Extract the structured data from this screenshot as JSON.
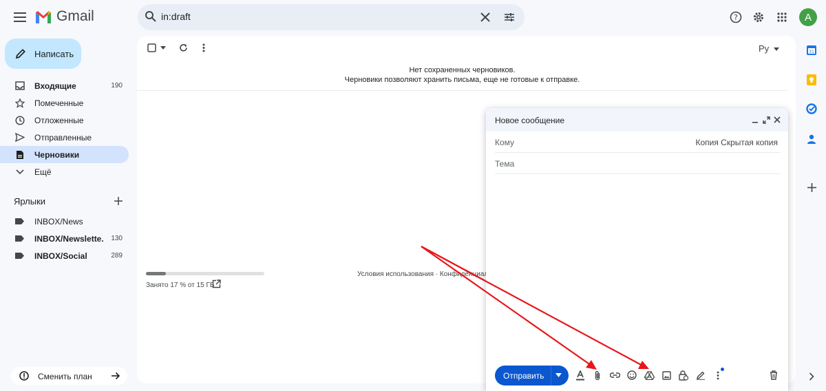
{
  "app": {
    "name": "Gmail"
  },
  "search": {
    "value": "in:draft"
  },
  "account": {
    "initial": "A"
  },
  "compose_button": {
    "label": "Написать"
  },
  "nav": [
    {
      "label": "Входящие",
      "count": "190",
      "bold": true,
      "icon": "inbox-icon"
    },
    {
      "label": "Помеченные",
      "count": "",
      "bold": false,
      "icon": "star-icon"
    },
    {
      "label": "Отложенные",
      "count": "",
      "bold": false,
      "icon": "clock-icon"
    },
    {
      "label": "Отправленные",
      "count": "",
      "bold": false,
      "icon": "send-icon"
    },
    {
      "label": "Черновики",
      "count": "",
      "bold": true,
      "icon": "draft-icon",
      "active": true
    },
    {
      "label": "Ещё",
      "count": "",
      "bold": false,
      "icon": "chevron-down-icon"
    }
  ],
  "labels": {
    "title": "Ярлыки",
    "items": [
      {
        "label": "INBOX/News",
        "count": "",
        "bold": false
      },
      {
        "label": "INBOX/Newslette...",
        "count": "130",
        "bold": true
      },
      {
        "label": "INBOX/Social",
        "count": "289",
        "bold": true
      }
    ]
  },
  "upgrade": {
    "label": "Сменить план"
  },
  "main": {
    "lang": "Ру",
    "empty_line1": "Нет сохраненных черновиков.",
    "empty_line2": "Черновики позволяют хранить письма, еще не готовые к отправке.",
    "storage_text": "Занято 17 % от 15 ГБ",
    "storage_fraction": 0.17,
    "footer_links": "Условия использования · Конфиденциальн"
  },
  "compose_window": {
    "title": "Новое сообщение",
    "to_label": "Кому",
    "cc_bcc": "Копия Скрытая копия",
    "subject_placeholder": "Тема",
    "send_label": "Отправить"
  },
  "colors": {
    "accent": "#0b57d0",
    "compose_bg": "#c2e7ff",
    "active_nav": "#d3e3fd",
    "annotation_arrow": "#e8161b"
  }
}
